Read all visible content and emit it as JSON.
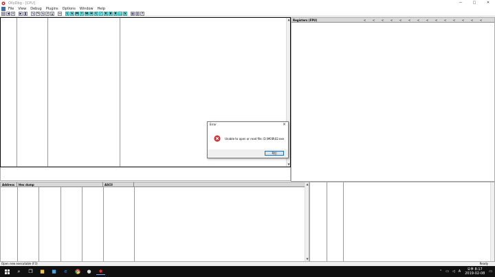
{
  "window": {
    "title": "OllyDbg - [CPU]",
    "controls": [
      "—",
      "□",
      "✕"
    ]
  },
  "menu": {
    "items": [
      "File",
      "View",
      "Debug",
      "Plugins",
      "Options",
      "Window",
      "Help"
    ]
  },
  "toolbar": {
    "letter_buttons": [
      "L",
      "E",
      "M",
      "T",
      "W",
      "H",
      "C",
      "/",
      "K",
      "B",
      "R",
      "...",
      "S"
    ],
    "help_label": "?"
  },
  "registers": {
    "header": "Registers (FPU)",
    "arrow_glyph": "<"
  },
  "dump": {
    "col_address": "Address",
    "col_hex": "Hex dump",
    "col_ascii": "ASCII"
  },
  "status": {
    "left": "Open new executable (F3)",
    "right": "Ready"
  },
  "dialog": {
    "title": "Error",
    "message": "Unable to open or read file: D:\\MOB\\02.exe",
    "ok_label": "확인"
  },
  "taskbar": {
    "time": "오후 8:17",
    "date": "2019-02-08",
    "ime": "A"
  },
  "colors": {
    "accent_cyan": "#6cf0f0",
    "error_red": "#d13438",
    "taskbar": "#101010"
  }
}
